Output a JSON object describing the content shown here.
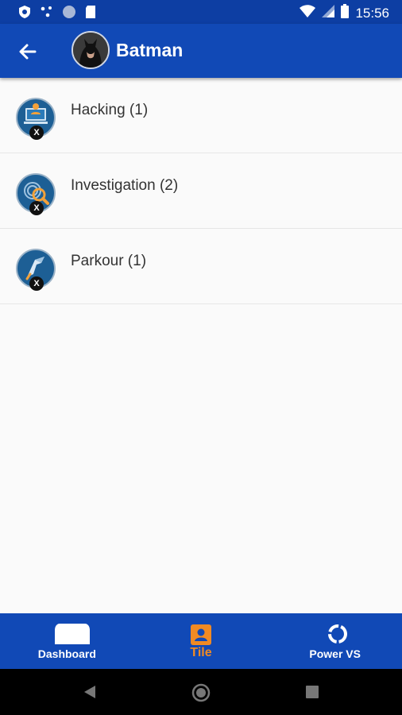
{
  "status_bar": {
    "time": "15:56"
  },
  "app_bar": {
    "title": "Batman"
  },
  "items": [
    {
      "label": "Hacking (1)",
      "icon": "hacking-icon"
    },
    {
      "label": "Investigation (2)",
      "icon": "investigation-icon"
    },
    {
      "label": "Parkour (1)",
      "icon": "parkour-icon"
    }
  ],
  "item_badge": "X",
  "bottom_nav": [
    {
      "label": "Dashboard",
      "icon": "dashboard-icon",
      "active": false
    },
    {
      "label": "Tile",
      "icon": "tile-icon",
      "active": true
    },
    {
      "label": "Power VS",
      "icon": "power-vs-icon",
      "active": false
    }
  ],
  "colors": {
    "primary": "#1149b6",
    "status_bar": "#0d3ea3",
    "active_tab": "#f08a24"
  }
}
